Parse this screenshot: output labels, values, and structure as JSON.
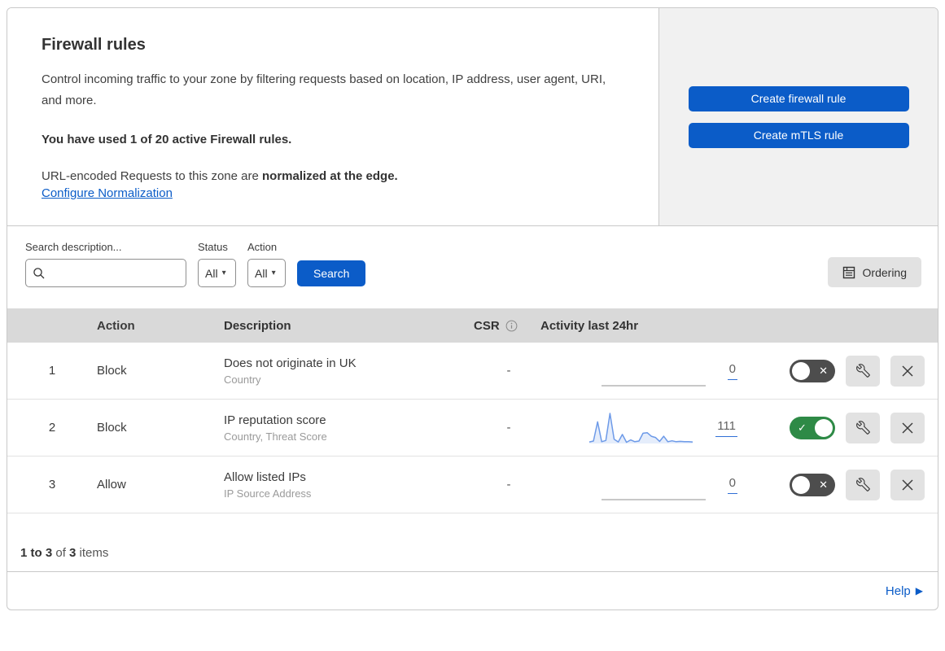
{
  "header": {
    "title": "Firewall rules",
    "description": "Control incoming traffic to your zone by filtering requests based on location, IP address, user agent, URI, and more.",
    "usage": "You have used 1 of 20 active Firewall rules.",
    "normalization_prefix": "URL-encoded Requests to this zone are ",
    "normalization_bold": "normalized at the edge.",
    "normalization_link": "Configure Normalization",
    "create_firewall_button": "Create firewall rule",
    "create_mtls_button": "Create mTLS rule"
  },
  "filters": {
    "search_label": "Search description...",
    "search_placeholder": "",
    "search_value": "",
    "status_label": "Status",
    "status_value": "All",
    "action_label": "Action",
    "action_value": "All",
    "search_button": "Search",
    "ordering_button": "Ordering"
  },
  "table": {
    "columns": {
      "action": "Action",
      "description": "Description",
      "csr": "CSR",
      "activity": "Activity last 24hr"
    },
    "rows": [
      {
        "number": "1",
        "action": "Block",
        "description": "Does not originate in UK",
        "fields": "Country",
        "csr": "-",
        "activity_count": "0",
        "enabled": false,
        "sparkline": null
      },
      {
        "number": "2",
        "action": "Block",
        "description": "IP reputation score",
        "fields": "Country, Threat Score",
        "csr": "-",
        "activity_count": "111",
        "enabled": true,
        "sparkline": [
          5,
          8,
          72,
          6,
          10,
          100,
          14,
          5,
          30,
          4,
          12,
          6,
          8,
          34,
          36,
          24,
          20,
          7,
          24,
          6,
          9,
          6,
          7,
          6,
          6,
          5
        ]
      },
      {
        "number": "3",
        "action": "Allow",
        "description": "Allow listed IPs",
        "fields": "IP Source Address",
        "csr": "-",
        "activity_count": "0",
        "enabled": false,
        "sparkline": null
      }
    ],
    "summary": {
      "range_bold": "1 to 3",
      "of_text": " of ",
      "total_bold": "3",
      "items_text": " items"
    }
  },
  "footer": {
    "help": "Help"
  },
  "icons": {
    "caret_down": "▾",
    "check": "✓",
    "cross": "✕",
    "help_arrow": "▶",
    "search": "magnifier-glyph",
    "ordering": "list-document-glyph",
    "info": "circled-i-glyph",
    "wrench": "wrench-glyph",
    "close": "x-glyph"
  },
  "colors": {
    "accent_blue": "#0b5cc8",
    "toggle_on_green": "#2e8a46",
    "toggle_off_gray": "#4d4d4d",
    "sparkline_blue": "#6d9ae8",
    "sparkline_fill": "rgba(109,154,232,0.18)",
    "empty_spark_gray": "#a8a8a8",
    "header_gray": "#d9d9d9",
    "panel_gray": "#f1f1f1"
  }
}
